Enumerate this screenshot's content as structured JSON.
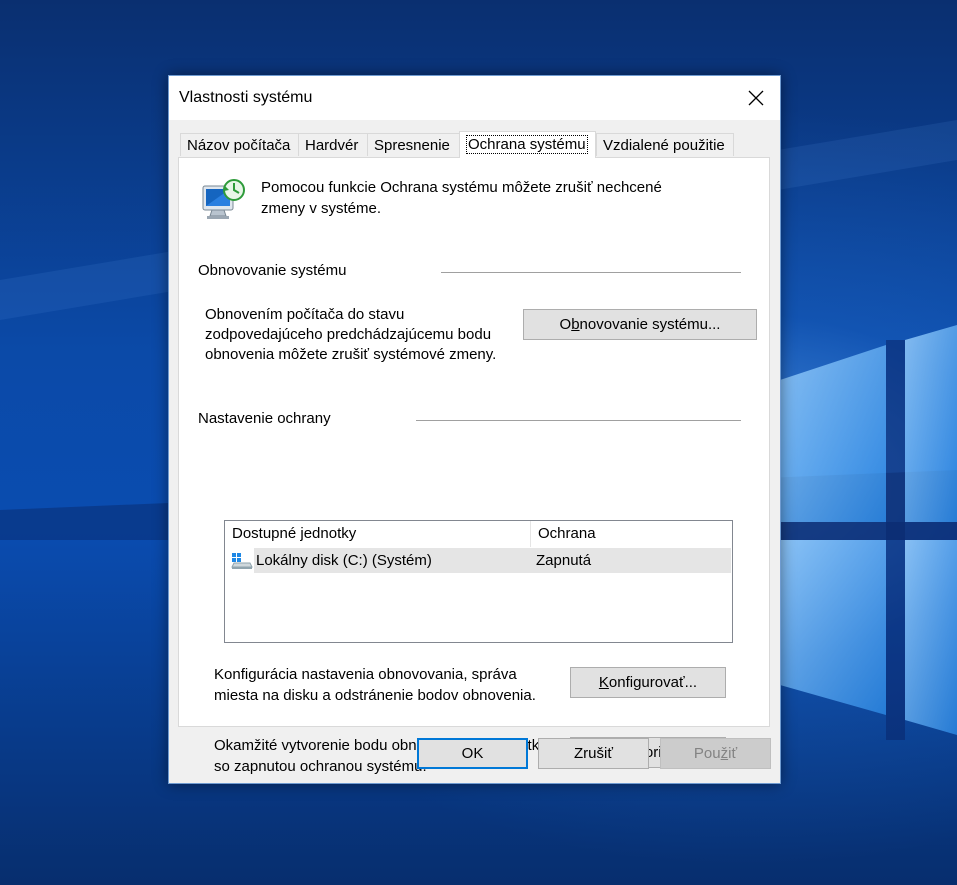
{
  "window": {
    "title": "Vlastnosti systému"
  },
  "tabs": [
    {
      "label": "Názov počítača"
    },
    {
      "label": "Hardvér"
    },
    {
      "label": "Spresnenie"
    },
    {
      "label": "Ochrana systému",
      "active": true
    },
    {
      "label": "Vzdialené použitie"
    }
  ],
  "intro": {
    "line1": "Pomocou funkcie Ochrana systému môžete zrušiť nechcené",
    "line2": "zmeny v systéme."
  },
  "restore": {
    "group_label": "Obnovovanie systému",
    "desc_line1": "Obnovením počítača do stavu",
    "desc_line2": "zodpovedajúceho predchádzajúcemu bodu",
    "desc_line3": "obnovenia môžete zrušiť systémové zmeny.",
    "button_pre": "O",
    "button_u": "b",
    "button_post": "novovanie systému..."
  },
  "protection": {
    "group_label": "Nastavenie ochrany",
    "columns": [
      "Dostupné jednotky",
      "Ochrana"
    ],
    "rows": [
      {
        "drive": "Lokálny disk (C:) (Systém)",
        "status": "Zapnutá"
      }
    ],
    "config_line1": "Konfigurácia nastavenia obnovovania, správa",
    "config_line2": "miesta na disku a odstránenie bodov obnovenia.",
    "config_btn_u": "K",
    "config_btn_post": "onfigurovať...",
    "create_line1": "Okamžité vytvorenie bodu obnovenia pre jednotky",
    "create_line2": "so zapnutou ochranou systému.",
    "create_btn_u": "V",
    "create_btn_post": "ytvoriť..."
  },
  "footer": {
    "ok": "OK",
    "cancel": "Zrušiť",
    "apply_pre": "Pou",
    "apply_u": "ž",
    "apply_post": "iť"
  },
  "colors": {
    "accent": "#0078d7",
    "desktop": "#0b4aa8"
  },
  "icons": [
    "close-icon",
    "system-protection-icon",
    "drive-icon",
    "windows-logo"
  ]
}
